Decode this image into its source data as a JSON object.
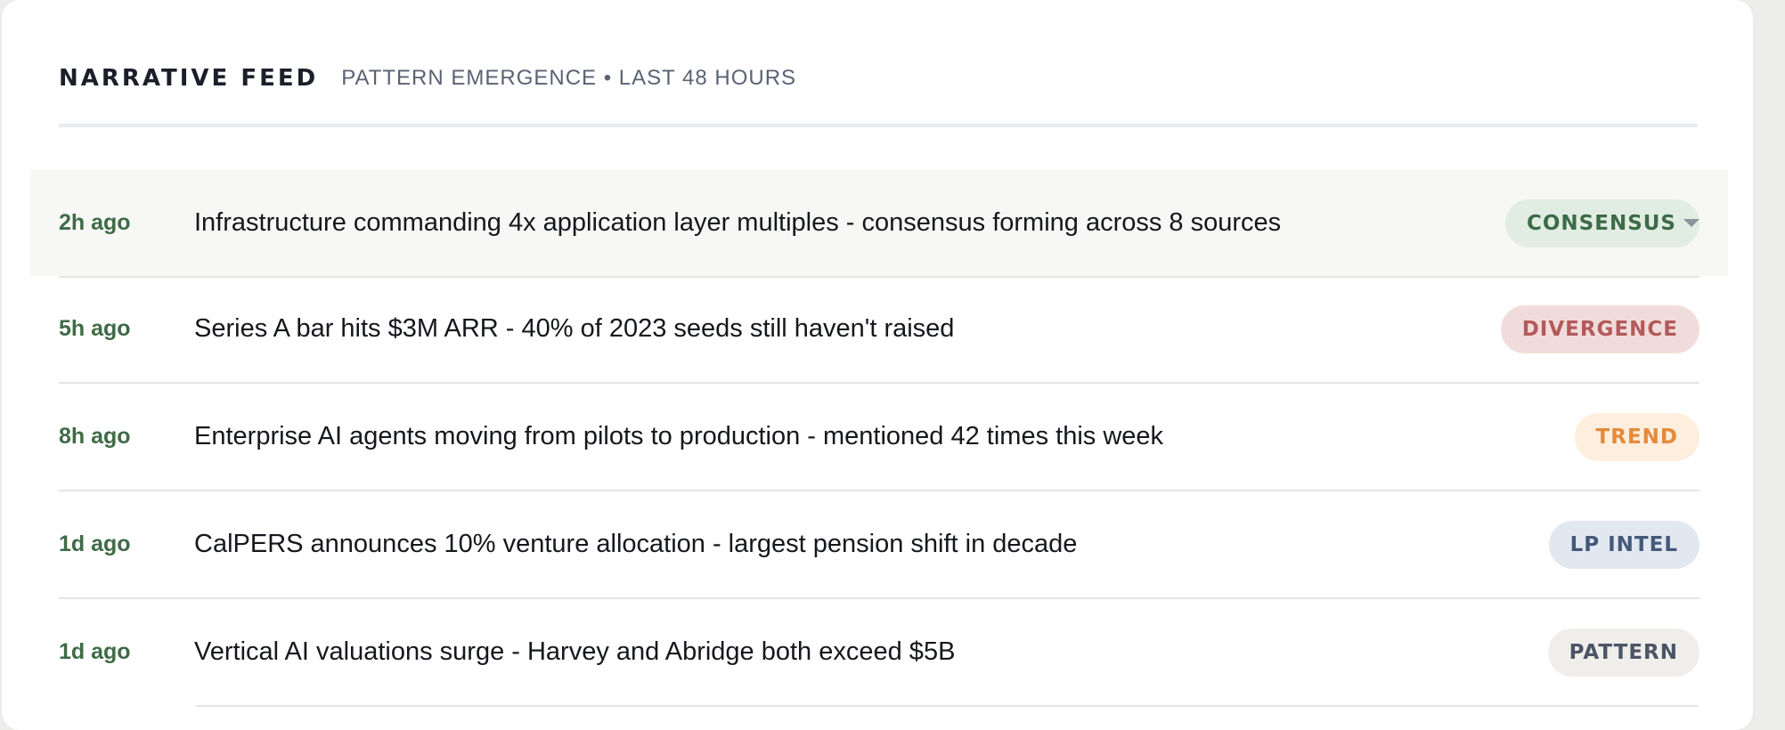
{
  "header": {
    "title": "NARRATIVE FEED",
    "subtitle": "PATTERN EMERGENCE • LAST 48 HOURS"
  },
  "items": [
    {
      "time": "2h ago",
      "text": "Infrastructure commanding 4x application layer multiples - consensus forming across 8 sources",
      "tag": "CONSENSUS",
      "hovered": true
    },
    {
      "time": "5h ago",
      "text": "Series A bar hits $3M ARR - 40% of 2023 seeds still haven't raised",
      "tag": "DIVERGENCE"
    },
    {
      "time": "8h ago",
      "text": "Enterprise AI agents moving from pilots to production - mentioned 42 times this week",
      "tag": "TREND"
    },
    {
      "time": "1d ago",
      "text": "CalPERS announces 10% venture allocation - largest pension shift in decade",
      "tag": "LP INTEL"
    },
    {
      "time": "1d ago",
      "text": "Vertical AI valuations surge - Harvey and Abridge both exceed $5B",
      "tag": "PATTERN"
    }
  ],
  "colors": {
    "time": "#3f6b46",
    "consensus": "#3d6b47",
    "divergence": "#b35a5a",
    "trend": "#e58a3a",
    "lp_intel": "#45597a",
    "pattern": "#4c5566"
  }
}
